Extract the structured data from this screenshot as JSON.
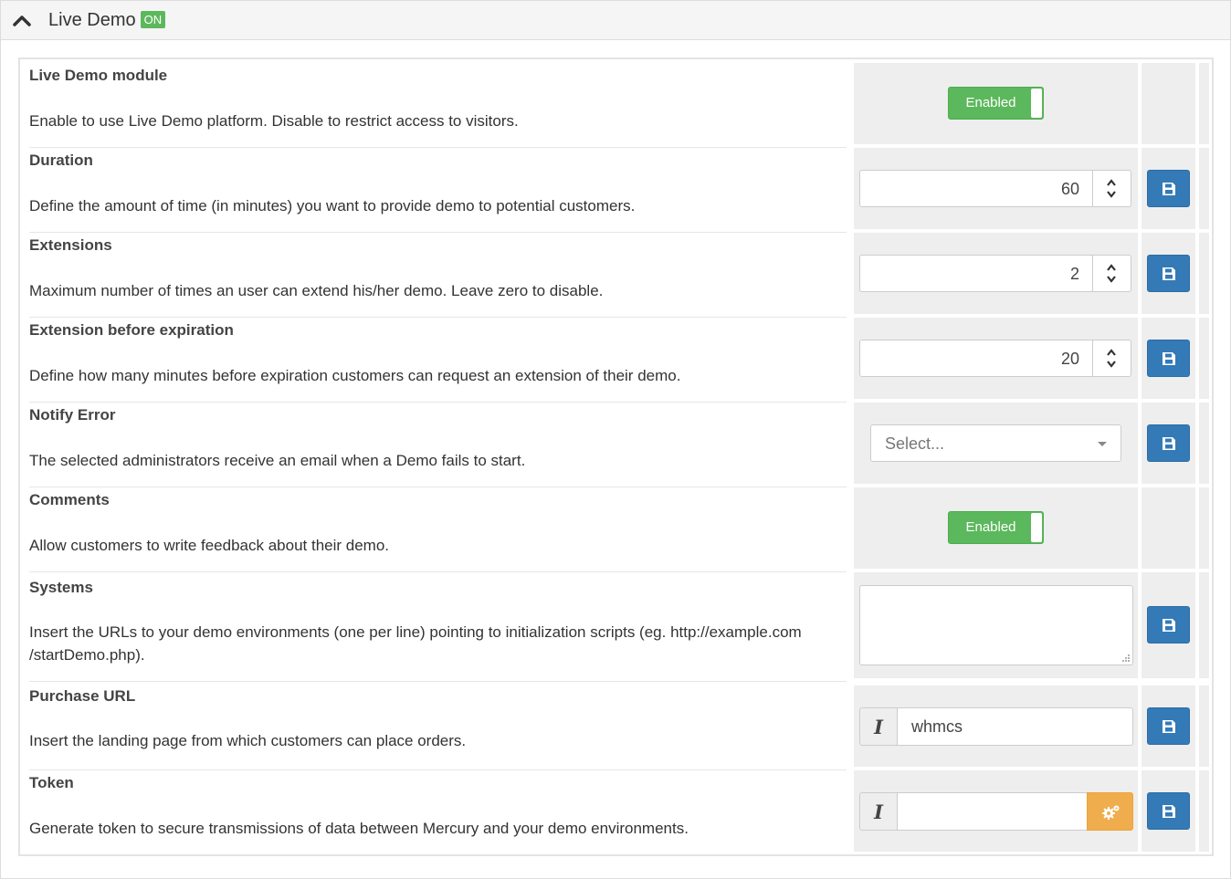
{
  "header": {
    "title": "Live Demo",
    "status_badge": "ON"
  },
  "settings": [
    {
      "title": "Live Demo module",
      "description": "Enable to use Live Demo platform. Disable to restrict access to visitors.",
      "control": "toggle",
      "toggle_label": "Enabled"
    },
    {
      "title": "Duration",
      "description": "Define the amount of time (in minutes) you want to provide demo to potential customers.",
      "control": "number",
      "value": "60"
    },
    {
      "title": "Extensions",
      "description": "Maximum number of times an user can extend his/her demo. Leave zero to disable.",
      "control": "number",
      "value": "2"
    },
    {
      "title": "Extension before expiration",
      "description": "Define how many minutes before expiration customers can request an extension of their demo.",
      "control": "number",
      "value": "20"
    },
    {
      "title": "Notify Error",
      "description": "The selected administrators receive an email when a Demo fails to start.",
      "control": "select",
      "placeholder": "Select..."
    },
    {
      "title": "Comments",
      "description": "Allow customers to write feedback about their demo.",
      "control": "toggle",
      "toggle_label": "Enabled"
    },
    {
      "title": "Systems",
      "description": "Insert the URLs to your demo environments (one per line) pointing to initialization scripts (eg. http://example.com /startDemo.php).",
      "control": "textarea",
      "value": ""
    },
    {
      "title": "Purchase URL",
      "description": "Insert the landing page from which customers can place orders.",
      "control": "addon-text",
      "addon": "I",
      "value": "whmcs"
    },
    {
      "title": "Token",
      "description": "Generate token to secure transmissions of data between Mercury and your demo environments.",
      "control": "addon-generate",
      "addon": "I",
      "value": ""
    }
  ],
  "icons": {
    "collapse": "chevron-up-icon",
    "save": "floppy-disk-icon",
    "generate": "gears-icon",
    "spinner_up": "caret-up-icon",
    "spinner_down": "caret-down-icon",
    "select_caret": "caret-down-icon"
  },
  "colors": {
    "toggle_on": "#5cb85c",
    "save_button": "#337ab7",
    "generate_button": "#f0ad4e",
    "badge_on": "#5cb85c"
  }
}
